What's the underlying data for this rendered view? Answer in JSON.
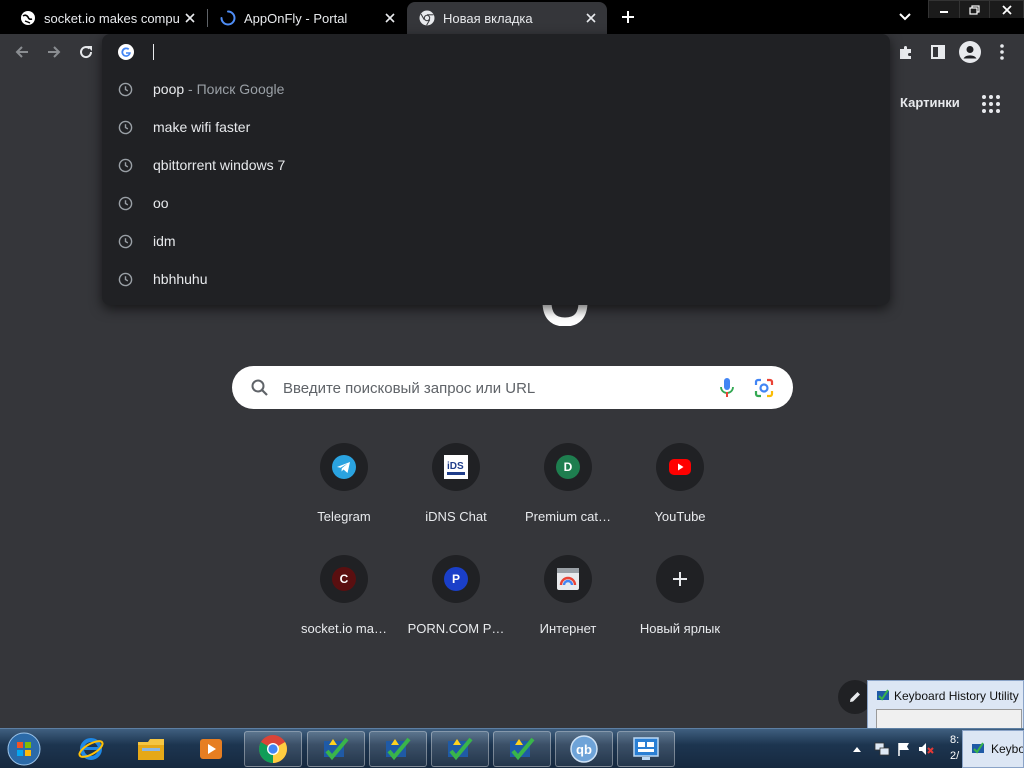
{
  "tabs": [
    {
      "title": "socket.io makes compute",
      "icon": "globe-icon",
      "active": false
    },
    {
      "title": "AppOnFly - Portal",
      "icon": "loading-spinner-icon",
      "active": false
    },
    {
      "title": "Новая вкладка",
      "icon": "chrome-icon",
      "active": true
    }
  ],
  "omnibox": {
    "value": "",
    "suggestions": [
      {
        "text": "poop",
        "desc": " - Поиск Google"
      },
      {
        "text": "make wifi faster",
        "desc": ""
      },
      {
        "text": "qbittorrent windows 7",
        "desc": ""
      },
      {
        "text": "oo",
        "desc": ""
      },
      {
        "text": "idm",
        "desc": ""
      },
      {
        "text": "hbhhuhu",
        "desc": ""
      }
    ]
  },
  "ntp": {
    "pictures_link": "Картинки",
    "search_placeholder": "Введите поисковый запрос или URL",
    "shortcuts": [
      {
        "label": "Telegram",
        "icon": "telegram-icon",
        "color": "#2aa3e0"
      },
      {
        "label": "iDNS Chat",
        "icon": "idns-icon",
        "color": "#1f3d8a"
      },
      {
        "label": "Premium cat…",
        "icon": "letter-d-icon",
        "letter": "D",
        "color": "#1e7e4f"
      },
      {
        "label": "YouTube",
        "icon": "youtube-icon",
        "color": "#ff0000"
      },
      {
        "label": "socket.io ma…",
        "icon": "letter-c-icon",
        "letter": "C",
        "color": "#5a0f10"
      },
      {
        "label": "PORN.COM P…",
        "icon": "letter-p-icon",
        "letter": "P",
        "color": "#1a3fc9"
      },
      {
        "label": "Интернет",
        "icon": "internet-icon",
        "color": "#e8eaed"
      },
      {
        "label": "Новый ярлык",
        "icon": "plus-icon",
        "color": "#e8eaed"
      }
    ]
  },
  "popup": {
    "title": "Keyboard History Utility"
  },
  "taskbar": {
    "clock_time": "8:",
    "clock_date": "2/",
    "kb_task_label": "Keyboard"
  }
}
